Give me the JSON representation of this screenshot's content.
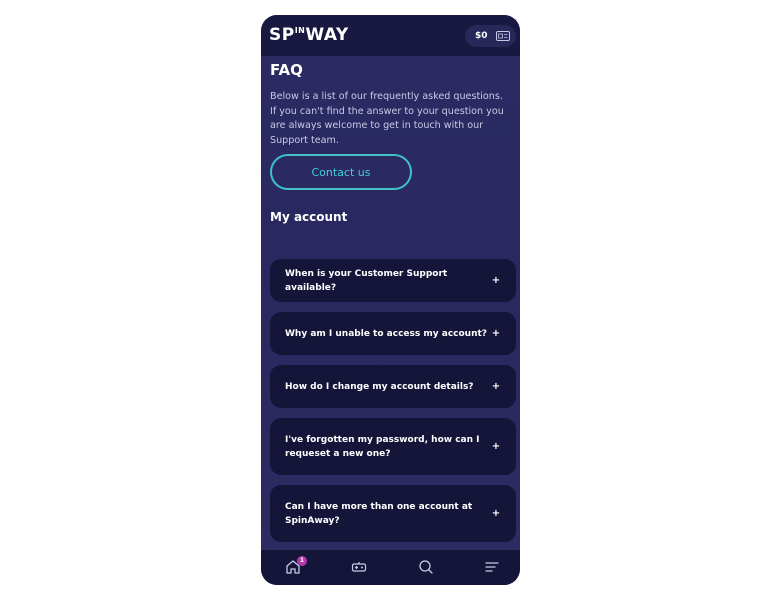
{
  "header": {
    "logo_text_left": "SP",
    "logo_text_right": "WAY",
    "logo_small": "IN",
    "balance": "$0",
    "wallet_icon": "wallet-icon"
  },
  "page": {
    "title": "FAQ",
    "intro": "Below is a list of our frequently asked questions. If you can't find the answer to your question you are always welcome to get in touch with our Support team.",
    "contact_label": "Contact us",
    "section_title": "My account"
  },
  "faq": [
    {
      "question": "When is your Customer Support available?",
      "toggle": "+"
    },
    {
      "question": "Why am I unable to access my account?",
      "toggle": "+"
    },
    {
      "question": "How do I change my account details?",
      "toggle": "+"
    },
    {
      "question": "I've forgotten my password, how can I requeset a new one?",
      "toggle": "+"
    },
    {
      "question": "Can I have more than one account at SpinAway?",
      "toggle": "+"
    }
  ],
  "bottom_nav": {
    "home_icon": "home-icon",
    "home_badge": "1",
    "games_icon": "gamepad-icon",
    "search_icon": "search-icon",
    "menu_icon": "menu-icon"
  },
  "colors": {
    "accent": "#3fc3c7",
    "badge": "#b23aa8",
    "card_bg": "#15153a",
    "page_bg": "#2b2b63"
  }
}
